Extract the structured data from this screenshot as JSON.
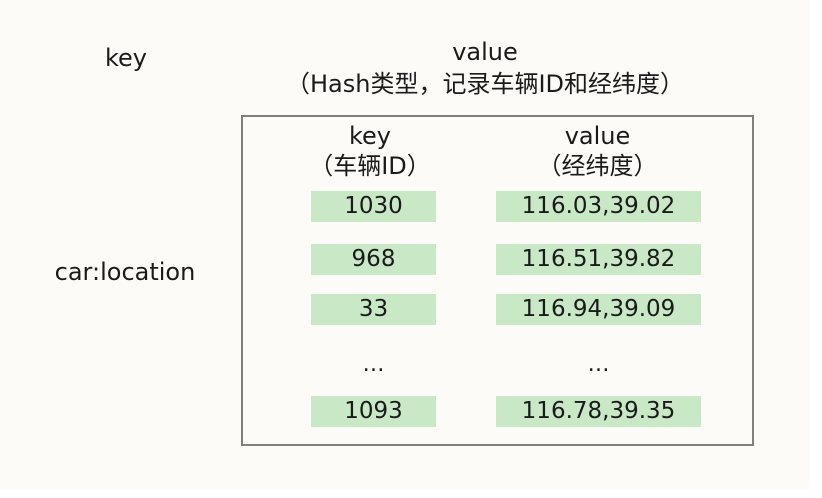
{
  "outer_key_header": "key",
  "outer_value_header": {
    "line1": "value",
    "line2": "（Hash类型，记录车辆ID和经纬度）"
  },
  "hash_key_name": "car:location",
  "inner_key_header": {
    "line1": "key",
    "line2": "（车辆ID）"
  },
  "inner_value_header": {
    "line1": "value",
    "line2": "（经纬度）"
  },
  "rows": [
    {
      "field": "1030",
      "value": "116.03,39.02"
    },
    {
      "field": "968",
      "value": "116.51,39.82"
    },
    {
      "field": "33",
      "value": "116.94,39.09"
    },
    {
      "field": "…",
      "value": "…"
    },
    {
      "field": "1093",
      "value": "116.78,39.35"
    }
  ],
  "colors": {
    "cell_fill": "#c8e8c6",
    "border": "#7f7f7f",
    "background": "#fcfbf7"
  }
}
